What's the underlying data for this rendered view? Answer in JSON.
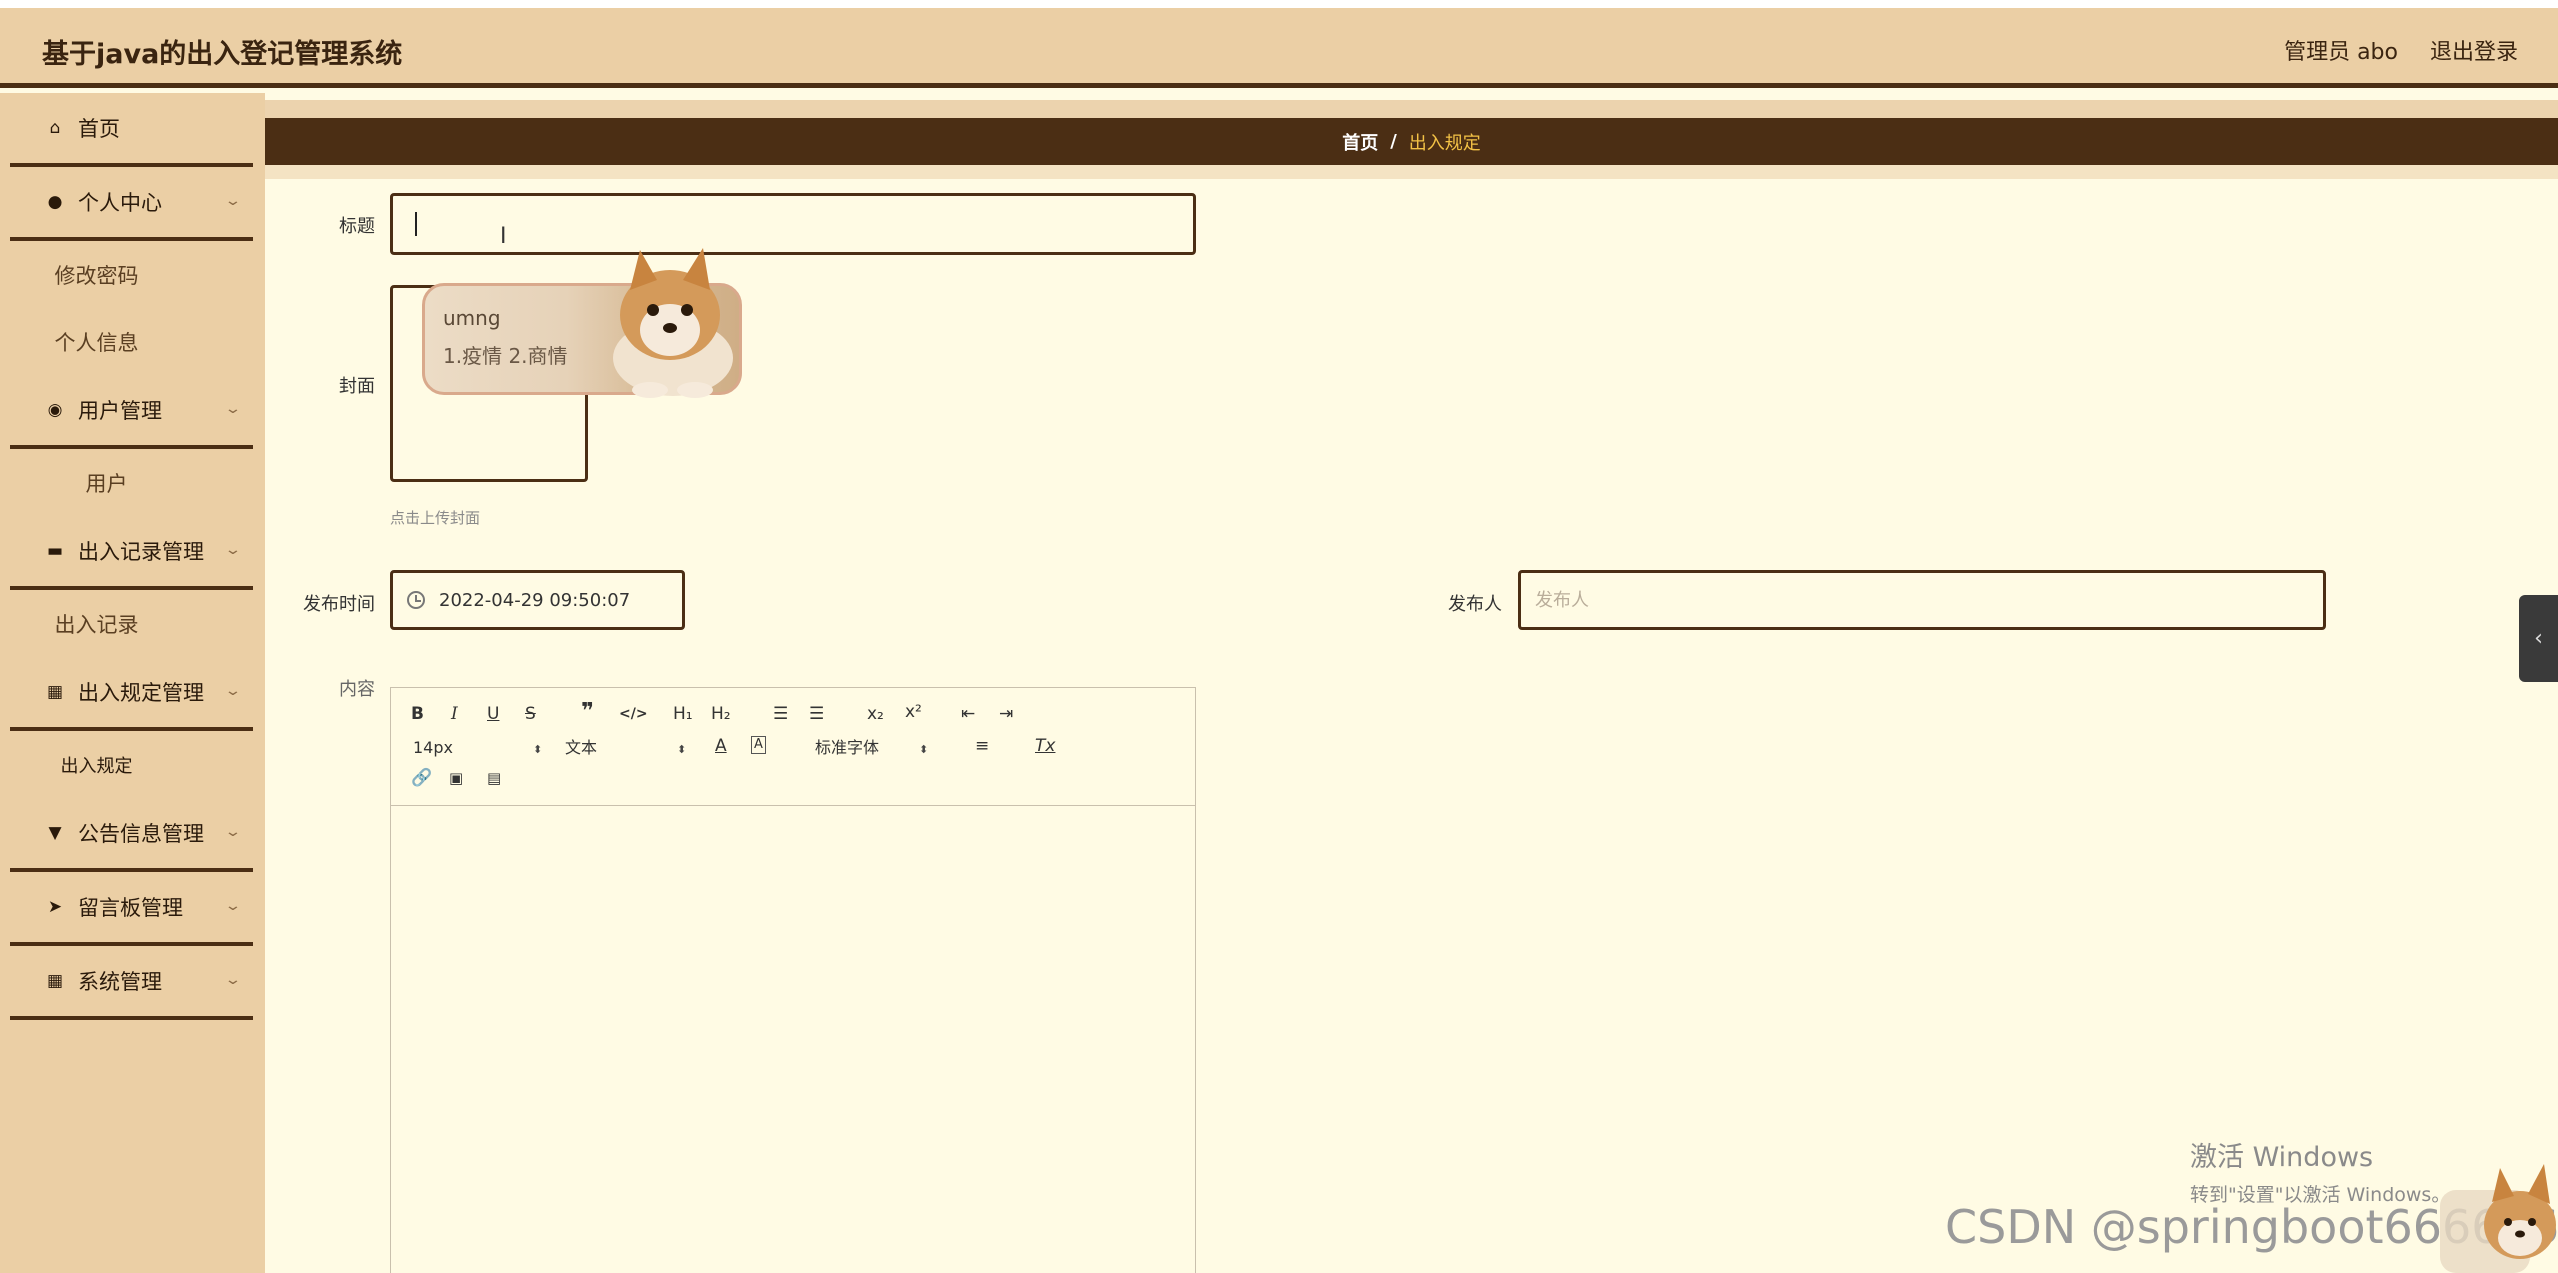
{
  "header": {
    "app_title": "基于java的出入登记管理系统",
    "user_label": "管理员 abo",
    "logout_label": "退出登录"
  },
  "sidebar": {
    "items": [
      {
        "label": "首页",
        "icon": "home-icon"
      },
      {
        "label": "个人中心",
        "icon": "user-icon",
        "children": [
          "修改密码",
          "个人信息"
        ]
      },
      {
        "label": "用户管理",
        "icon": "pin-icon",
        "children": [
          "用户"
        ]
      },
      {
        "label": "出入记录管理",
        "icon": "folder-icon",
        "children": [
          "出入记录"
        ]
      },
      {
        "label": "出入规定管理",
        "icon": "grid-icon",
        "children": [
          "出入规定"
        ]
      },
      {
        "label": "公告信息管理",
        "icon": "flag-icon"
      },
      {
        "label": "留言板管理",
        "icon": "send-icon"
      },
      {
        "label": "系统管理",
        "icon": "grid-icon"
      }
    ]
  },
  "breadcrumb": {
    "home": "首页",
    "separator": "/",
    "current": "出入规定"
  },
  "form": {
    "title_label": "标题",
    "title_value": "",
    "cover_label": "封面",
    "cover_hint": "点击上传封面",
    "time_label": "发布时间",
    "time_value": "2022-04-29 09:50:07",
    "publisher_label": "发布人",
    "publisher_placeholder": "发布人",
    "content_label": "内容"
  },
  "editor": {
    "font_size": "14px",
    "header_select": "文本",
    "font_family": "标准字体",
    "buttons": {
      "bold": "B",
      "italic": "I",
      "underline": "U",
      "strike": "S",
      "h1": "H₁",
      "h2": "H₂",
      "sub": "x₂",
      "sup": "x²",
      "clean": "Tx"
    }
  },
  "ime": {
    "input": "umng",
    "candidates": "1.疫情  2.商情"
  },
  "watermark": {
    "title": "激活 Windows",
    "subtitle": "转到\"设置\"以激活 Windows。"
  },
  "overlay_text": "CSDN @springboot666666",
  "colors": {
    "header_bg": "#ebcfa5",
    "dark": "#4b2e14",
    "accent": "#f3c246",
    "content_bg": "#fffbe4"
  }
}
